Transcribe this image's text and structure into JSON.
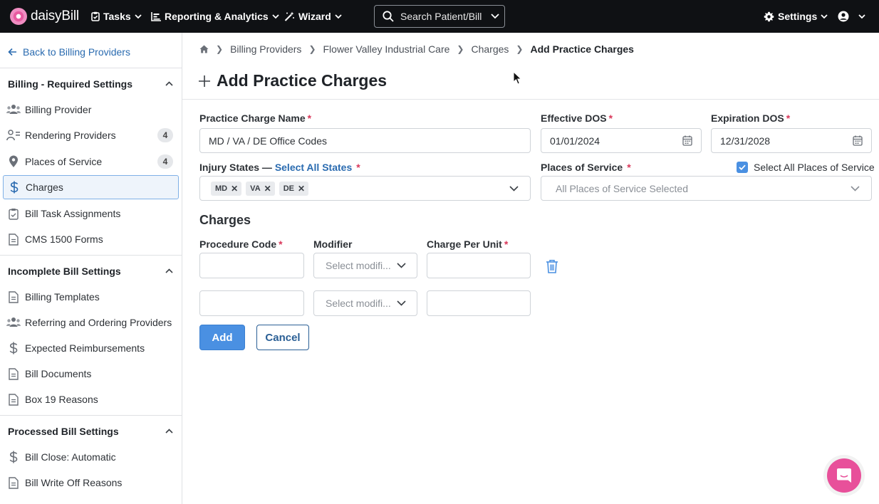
{
  "nav": {
    "logo_text": "daisyBill",
    "tasks": "Tasks",
    "reporting": "Reporting & Analytics",
    "wizard": "Wizard",
    "search": "Search Patient/Bill",
    "settings": "Settings"
  },
  "sidebar": {
    "back": "Back to Billing Providers",
    "sections": [
      {
        "title": "Billing - Required Settings",
        "items": [
          {
            "label": "Billing Provider",
            "icon": "users-icon"
          },
          {
            "label": "Rendering Providers",
            "icon": "user-list-icon",
            "badge": "4"
          },
          {
            "label": "Places of Service",
            "icon": "map-pin-icon",
            "badge": "4"
          },
          {
            "label": "Charges",
            "icon": "dollar-icon",
            "active": true
          },
          {
            "label": "Bill Task Assignments",
            "icon": "clipboard-check-icon"
          },
          {
            "label": "CMS 1500 Forms",
            "icon": "document-icon"
          }
        ]
      },
      {
        "title": "Incomplete Bill Settings",
        "items": [
          {
            "label": "Billing Templates",
            "icon": "document-icon"
          },
          {
            "label": "Referring and Ordering Providers",
            "icon": "users-icon"
          },
          {
            "label": "Expected Reimbursements",
            "icon": "dollar-icon"
          },
          {
            "label": "Bill Documents",
            "icon": "document-icon"
          },
          {
            "label": "Box 19 Reasons",
            "icon": "document-icon"
          }
        ]
      },
      {
        "title": "Processed Bill Settings",
        "items": [
          {
            "label": "Bill Close: Automatic",
            "icon": "dollar-icon"
          },
          {
            "label": "Bill Write Off Reasons",
            "icon": "document-icon"
          }
        ]
      }
    ]
  },
  "breadcrumb": [
    "Billing Providers",
    "Flower Valley Industrial Care",
    "Charges",
    "Add Practice Charges"
  ],
  "page_title": "Add Practice Charges",
  "form": {
    "charge_name_label": "Practice Charge Name",
    "charge_name_value": "MD / VA / DE Office Codes",
    "effective_label": "Effective DOS",
    "effective_value": "01/01/2024",
    "expiration_label": "Expiration DOS",
    "expiration_value": "12/31/2028",
    "injury_label": "Injury States —",
    "injury_select_all": "Select All States",
    "injury_states": [
      "MD",
      "VA",
      "DE"
    ],
    "pos_label": "Places of Service",
    "pos_select_all_label": "Select All Places of Service",
    "pos_select_all_checked": true,
    "pos_value": "All Places of Service Selected",
    "required_mark": "*"
  },
  "charges": {
    "title": "Charges",
    "procedure_label": "Procedure Code",
    "modifier_label": "Modifier",
    "charge_label": "Charge Per Unit",
    "modifier_placeholder": "Select modifi...",
    "rows": [
      {
        "procedure": "",
        "modifier": "",
        "charge": ""
      },
      {
        "procedure": "",
        "modifier": "",
        "charge": ""
      }
    ]
  },
  "buttons": {
    "add": "Add",
    "cancel": "Cancel"
  },
  "colors": {
    "primary": "#4a90e2",
    "link": "#2a6bb0",
    "required": "#d9385a",
    "nav_bg": "#0f1114",
    "chat": "#e8509a"
  }
}
